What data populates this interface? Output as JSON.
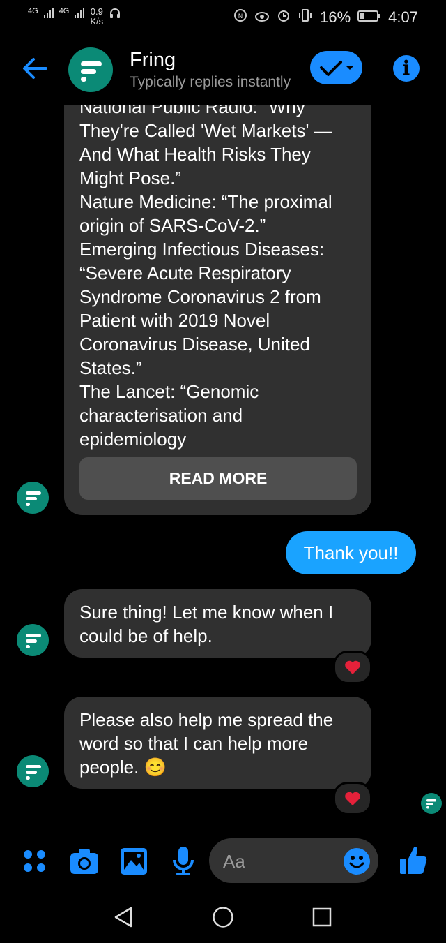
{
  "status_bar": {
    "net1": "4G",
    "net2": "4G",
    "speed_value": "0.9",
    "speed_unit": "K/s",
    "battery": "16%",
    "time": "4:07"
  },
  "header": {
    "title": "Fring",
    "subtitle": "Typically replies instantly"
  },
  "messages": {
    "long_text": "National Public Radio: “Why\nThey're Called 'Wet Markets' —\nAnd What Health Risks They\nMight Pose.”\nNature Medicine: “The proximal\norigin of SARS-CoV-2.”\nEmerging Infectious Diseases:\n“Severe Acute Respiratory\nSyndrome Coronavirus 2 from\nPatient with 2019 Novel\nCoronavirus Disease, United\nStates.”\nThe Lancet: “Genomic\ncharacterisation and\nepidemiology",
    "read_more": "READ MORE",
    "sent": "Thank you!!",
    "reply1": "Sure thing! Let me know when I\ncould be of help.",
    "reply2": "Please also help me spread the\nword so that I can help more\npeople. 😊"
  },
  "composer": {
    "placeholder": "Aa"
  },
  "colors": {
    "accent": "#1a8cff",
    "avatar": "#0b8a76",
    "bubble": "#303030",
    "heart": "#e5213a"
  },
  "icons": [
    "back-arrow-icon",
    "check-icon",
    "info-icon",
    "menu-dots-icon",
    "camera-icon",
    "image-icon",
    "mic-icon",
    "emoji-icon",
    "thumbs-up-icon",
    "heart-icon",
    "back-nav-icon",
    "home-nav-icon",
    "recents-nav-icon"
  ]
}
